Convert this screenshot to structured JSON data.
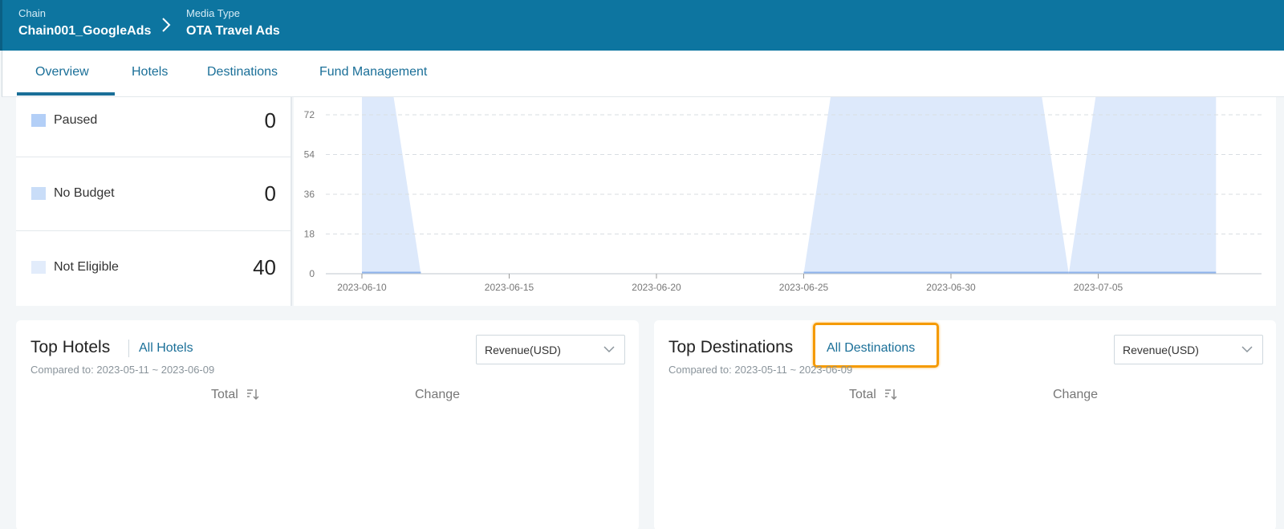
{
  "breadcrumb": {
    "chain_label": "Chain",
    "chain_value": "Chain001_GoogleAds",
    "media_label": "Media Type",
    "media_value": "OTA Travel Ads"
  },
  "tabs": [
    {
      "label": "Overview",
      "active": true
    },
    {
      "label": "Hotels"
    },
    {
      "label": "Destinations"
    },
    {
      "label": "Fund Management"
    }
  ],
  "status_rows": [
    {
      "name": "Paused",
      "value": "0",
      "color": "#b3cff7"
    },
    {
      "name": "No Budget",
      "value": "0",
      "color": "#c9ddf8"
    },
    {
      "name": "Not Eligible",
      "value": "40",
      "color": "#e2ecfb"
    }
  ],
  "chart_data": {
    "type": "area",
    "y_ticks": [
      "72",
      "54",
      "36",
      "18",
      "0"
    ],
    "x_ticks": [
      "2023-06-10",
      "2023-06-15",
      "2023-06-20",
      "2023-06-25",
      "2023-06-30",
      "2023-07-05"
    ],
    "ylim": [
      0,
      72
    ],
    "grid": true,
    "segments": [
      {
        "start": "2023-06-10",
        "end": "2023-06-12"
      },
      {
        "start": "2023-06-25",
        "end": "2023-07-04"
      },
      {
        "start": "2023-07-04",
        "end": "2023-07-09"
      }
    ],
    "colors": {
      "fill": "#dde9fb",
      "line": "#8fb4ec"
    }
  },
  "top_hotels": {
    "title": "Top Hotels",
    "link": "All Hotels",
    "compared": "Compared to: 2023-05-11 ~ 2023-06-09",
    "select_value": "Revenue(USD)",
    "col_total": "Total",
    "col_change": "Change"
  },
  "top_destinations": {
    "title": "Top Destinations",
    "link": "All Destinations",
    "compared": "Compared to: 2023-05-11 ~ 2023-06-09",
    "select_value": "Revenue(USD)",
    "col_total": "Total",
    "col_change": "Change"
  },
  "icons": {
    "breadcrumb_separator": "chevron-right-icon",
    "select_arrow": "chevron-down-icon",
    "sort": "sort-descending-icon"
  },
  "colors": {
    "header_bg": "#0d75a0",
    "link": "#1a6f98",
    "highlight": "#f59a00"
  }
}
